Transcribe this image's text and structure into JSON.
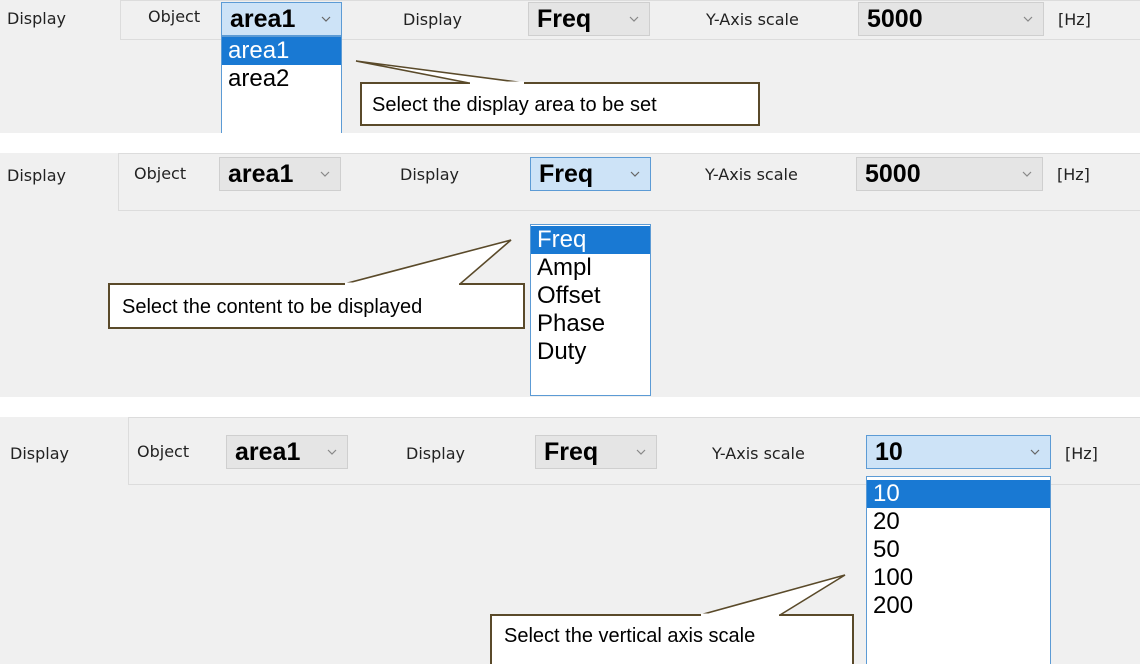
{
  "colors": {
    "panel_bg": "#f0f0f0",
    "combo_bg": "#e5e5e5",
    "combo_focus_bg": "#cde3f7",
    "focus_border": "#5c9bd5",
    "selection_bg": "#1979d3",
    "callout_border": "#5a4a2a"
  },
  "panels": [
    {
      "section_label": "Display",
      "object": {
        "label": "Object",
        "value": "area1"
      },
      "display": {
        "label": "Display",
        "value": "Freq"
      },
      "yaxis": {
        "label": "Y-Axis scale",
        "value": "5000",
        "unit": "[Hz]"
      },
      "open_dropdown": "object",
      "options": [
        "area1",
        "area2"
      ],
      "selected_option": "area1",
      "callout": "Select the display area to be set"
    },
    {
      "section_label": "Display",
      "object": {
        "label": "Object",
        "value": "area1"
      },
      "display": {
        "label": "Display",
        "value": "Freq"
      },
      "yaxis": {
        "label": "Y-Axis scale",
        "value": "5000",
        "unit": "[Hz]"
      },
      "open_dropdown": "display",
      "options": [
        "Freq",
        "Ampl",
        "Offset",
        "Phase",
        "Duty"
      ],
      "selected_option": "Freq",
      "callout": "Select the content to be displayed"
    },
    {
      "section_label": "Display",
      "object": {
        "label": "Object",
        "value": "area1"
      },
      "display": {
        "label": "Display",
        "value": "Freq"
      },
      "yaxis": {
        "label": "Y-Axis scale",
        "value": "10",
        "unit": "[Hz]"
      },
      "open_dropdown": "yaxis",
      "options": [
        "10",
        "20",
        "50",
        "100",
        "200"
      ],
      "selected_option": "10",
      "callout": "Select the vertical axis scale"
    }
  ]
}
